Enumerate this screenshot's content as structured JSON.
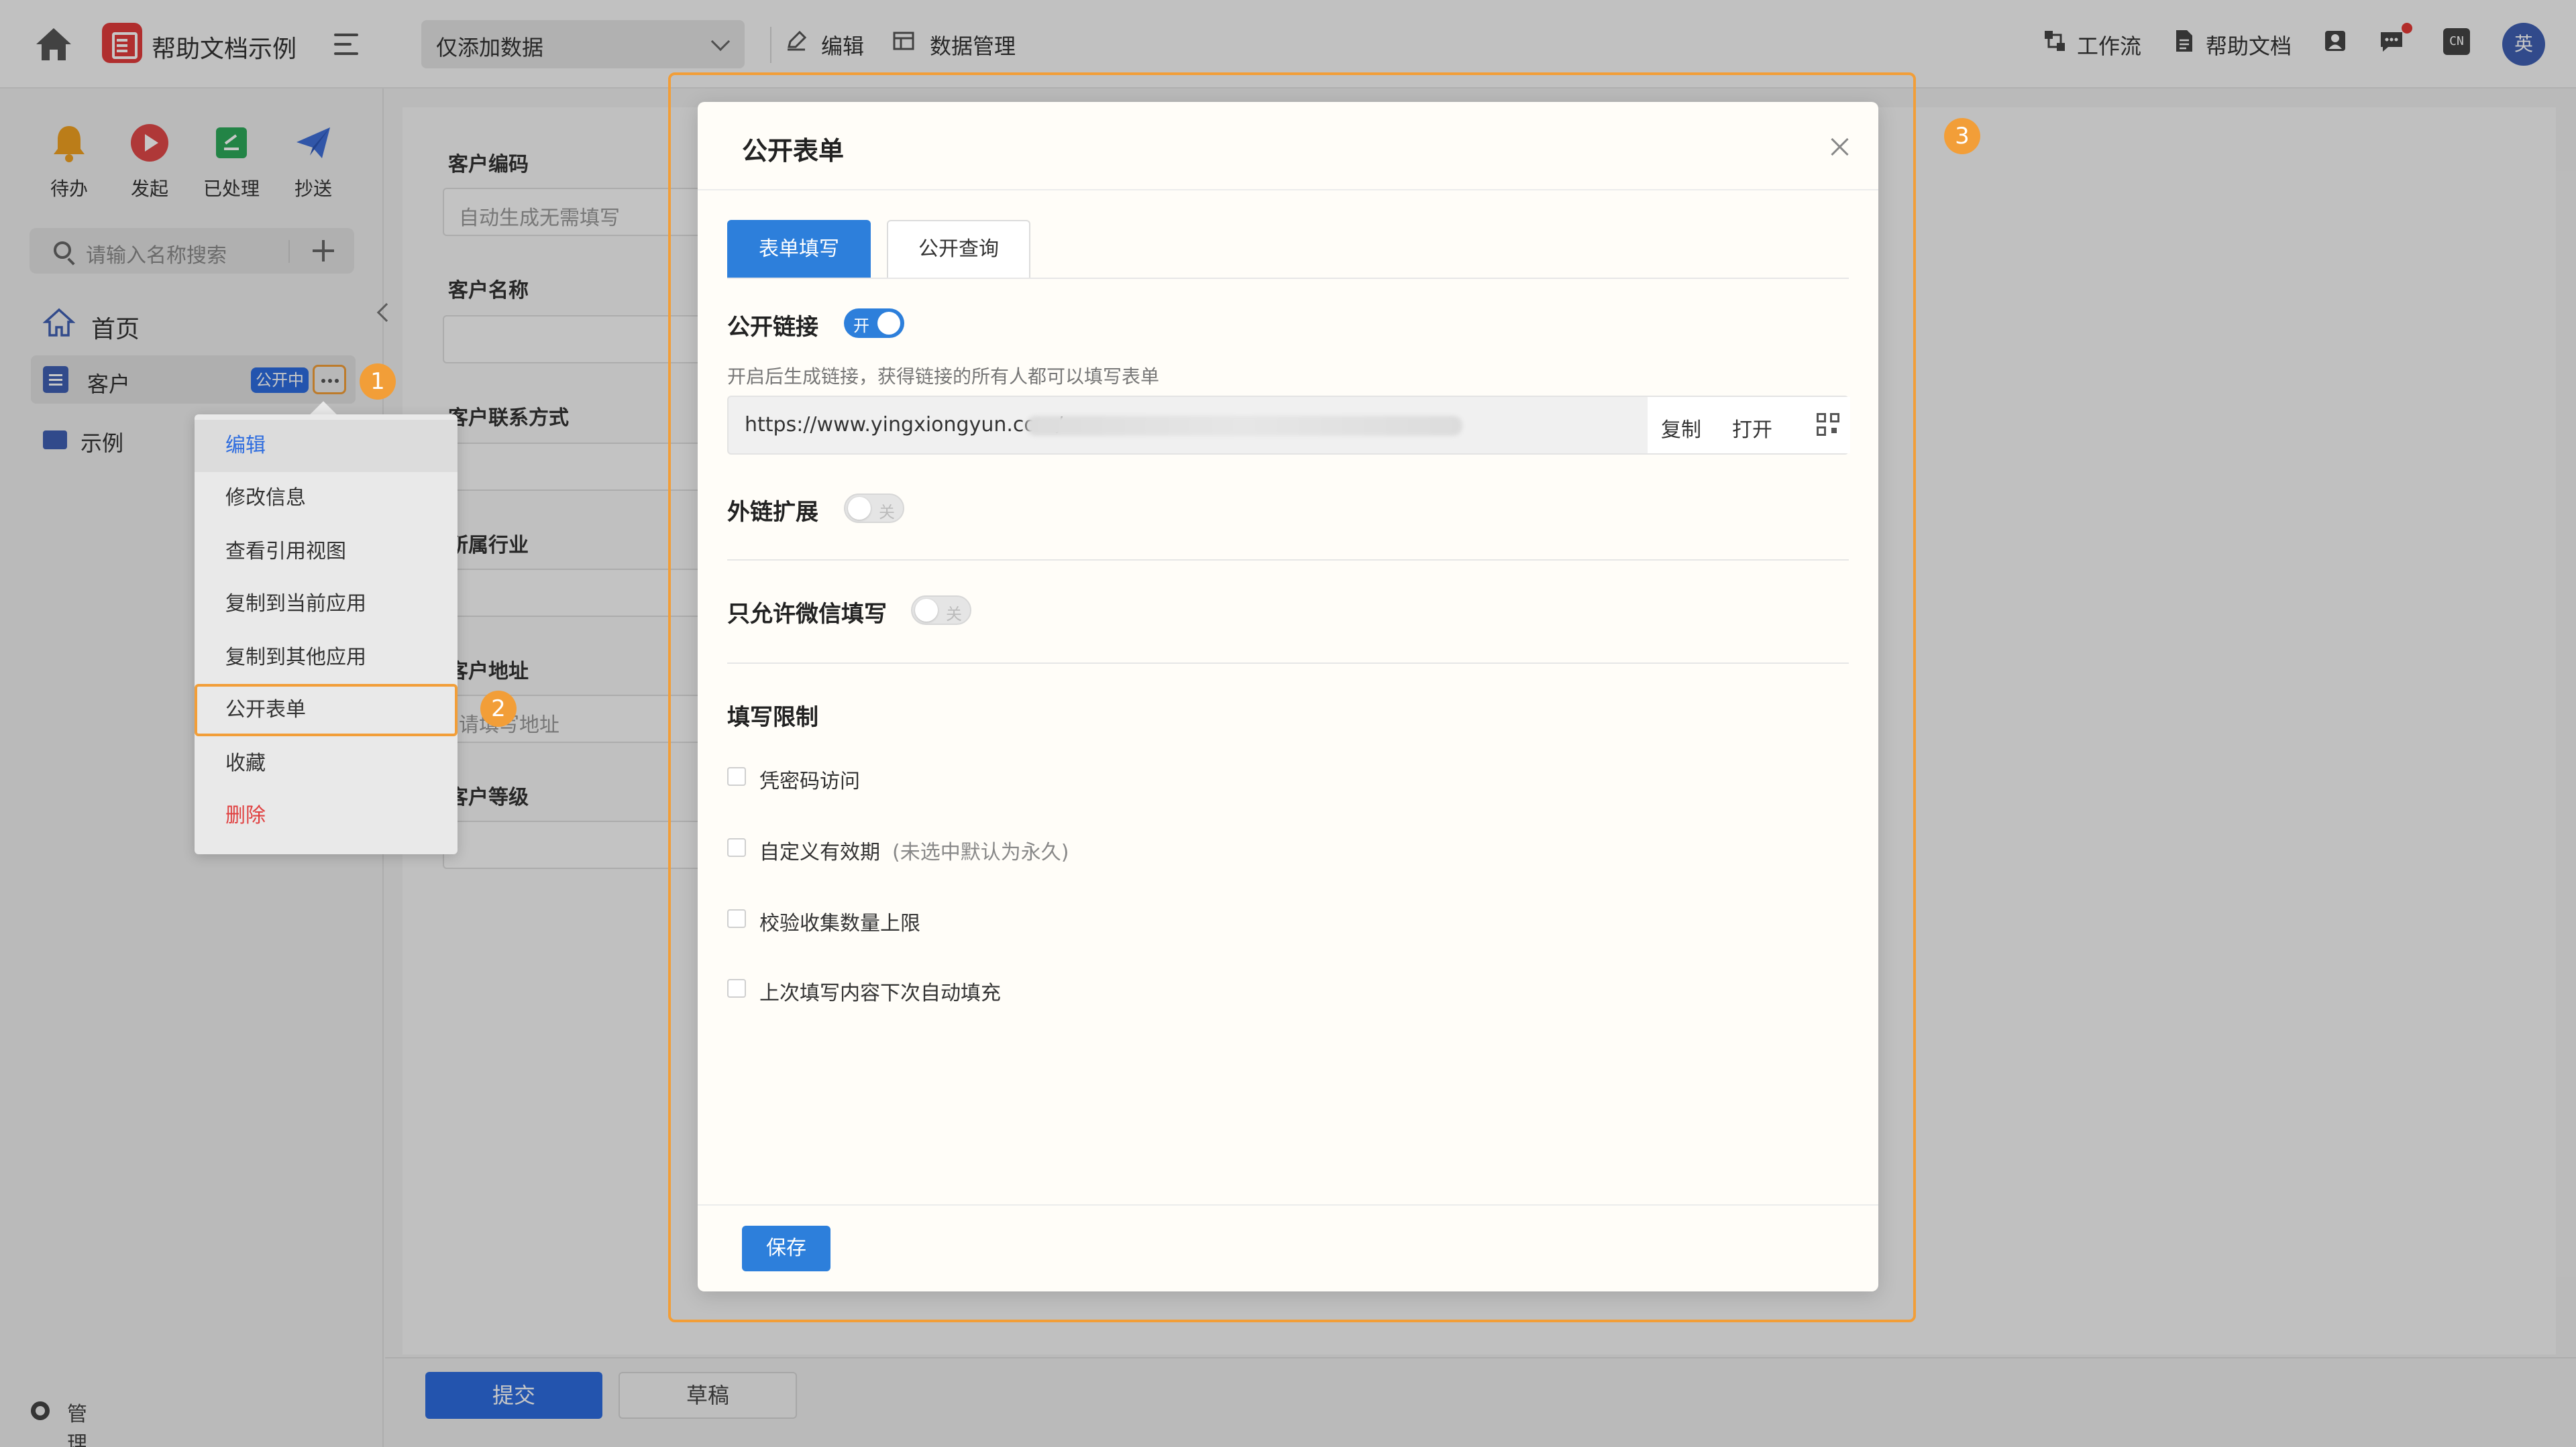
{
  "app": {
    "title": "帮助文档示例"
  },
  "header": {
    "select_value": "仅添加数据",
    "edit_label": "编辑",
    "data_manage_label": "数据管理",
    "workflow_label": "工作流",
    "help_label": "帮助文档",
    "lang_label": "CN",
    "avatar_text": "英"
  },
  "sidebar": {
    "quick": [
      {
        "label": "待办",
        "icon": "bell-icon",
        "color": "#f0a020"
      },
      {
        "label": "发起",
        "icon": "play-icon",
        "color": "#e04848"
      },
      {
        "label": "已处理",
        "icon": "done-icon",
        "color": "#2eaa5a"
      },
      {
        "label": "抄送",
        "icon": "send-icon",
        "color": "#3f6fd8"
      }
    ],
    "search_placeholder": "请输入名称搜索",
    "home_label": "首页",
    "item_label": "客户",
    "item_badge": "公开中",
    "folder_label": "示例",
    "admin_label": "管理后台"
  },
  "context_menu": {
    "items": [
      {
        "label": "编辑"
      },
      {
        "label": "修改信息"
      },
      {
        "label": "查看引用视图"
      },
      {
        "label": "复制到当前应用"
      },
      {
        "label": "复制到其他应用"
      },
      {
        "label": "公开表单"
      },
      {
        "label": "收藏"
      },
      {
        "label": "删除"
      }
    ]
  },
  "markers": {
    "m1": "1",
    "m2": "2",
    "m3": "3"
  },
  "form": {
    "fields": [
      {
        "label": "客户编码",
        "placeholder": "自动生成无需填写"
      },
      {
        "label": "客户名称",
        "placeholder": ""
      },
      {
        "label": "客户联系方式",
        "placeholder": ""
      },
      {
        "label": "所属行业",
        "placeholder": ""
      },
      {
        "label": "客户地址",
        "placeholder": "请填写地址"
      },
      {
        "label": "客户等级",
        "placeholder": ""
      }
    ],
    "submit_label": "提交",
    "draft_label": "草稿"
  },
  "modal": {
    "title": "公开表单",
    "tabs": [
      {
        "label": "表单填写"
      },
      {
        "label": "公开查询"
      }
    ],
    "public_link": {
      "title": "公开链接",
      "toggle_on": "开",
      "hint": "开启后生成链接，获得链接的所有人都可以填写表单",
      "url": "https://www.yingxiongyun.com/",
      "copy_label": "复制",
      "open_label": "打开"
    },
    "ext_link": {
      "title": "外链扩展",
      "toggle_off": "关"
    },
    "wechat_only": {
      "title": "只允许微信填写",
      "toggle_off": "关"
    },
    "limits": {
      "title": "填写限制",
      "items": [
        {
          "label": "凭密码访问",
          "note": ""
        },
        {
          "label": "自定义有效期",
          "note": "(未选中默认为永久)"
        },
        {
          "label": "校验收集数量上限",
          "note": ""
        },
        {
          "label": "上次填写内容下次自动填充",
          "note": ""
        }
      ]
    },
    "save_label": "保存"
  },
  "colors": {
    "accent": "#2d7fdb",
    "highlight": "#f29e38",
    "danger": "#e04040"
  }
}
